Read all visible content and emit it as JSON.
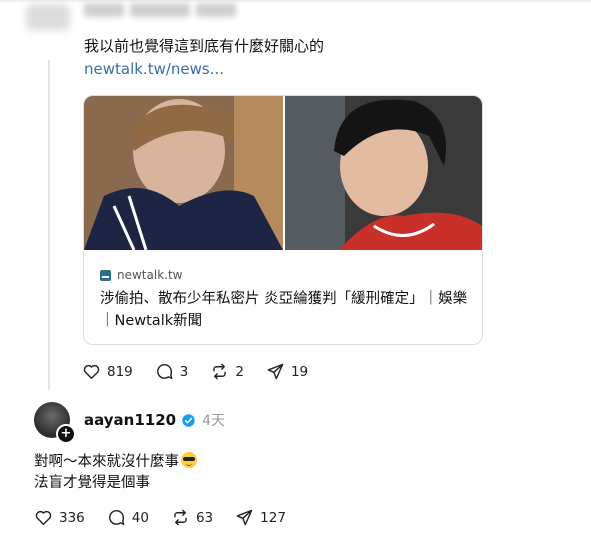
{
  "post": {
    "text": "我以前也覺得這到底有什麼好關心的",
    "link": "newtalk.tw/news..."
  },
  "card": {
    "domain": "newtalk.tw",
    "title": "涉偷拍、散布少年私密片 炎亞綸獲判「緩刑確定」｜娛樂｜Newtalk新聞"
  },
  "post_stats": {
    "likes": "819",
    "comments": "3",
    "reposts": "2",
    "shares": "19"
  },
  "reply": {
    "username": "aayan1120",
    "time": "4天",
    "line1": "對啊～本來就沒什麼事",
    "line2": "法盲才覺得是個事",
    "emoji": "sunglasses-emoji"
  },
  "reply_stats": {
    "likes": "336",
    "comments": "40",
    "reposts": "63",
    "shares": "127"
  }
}
